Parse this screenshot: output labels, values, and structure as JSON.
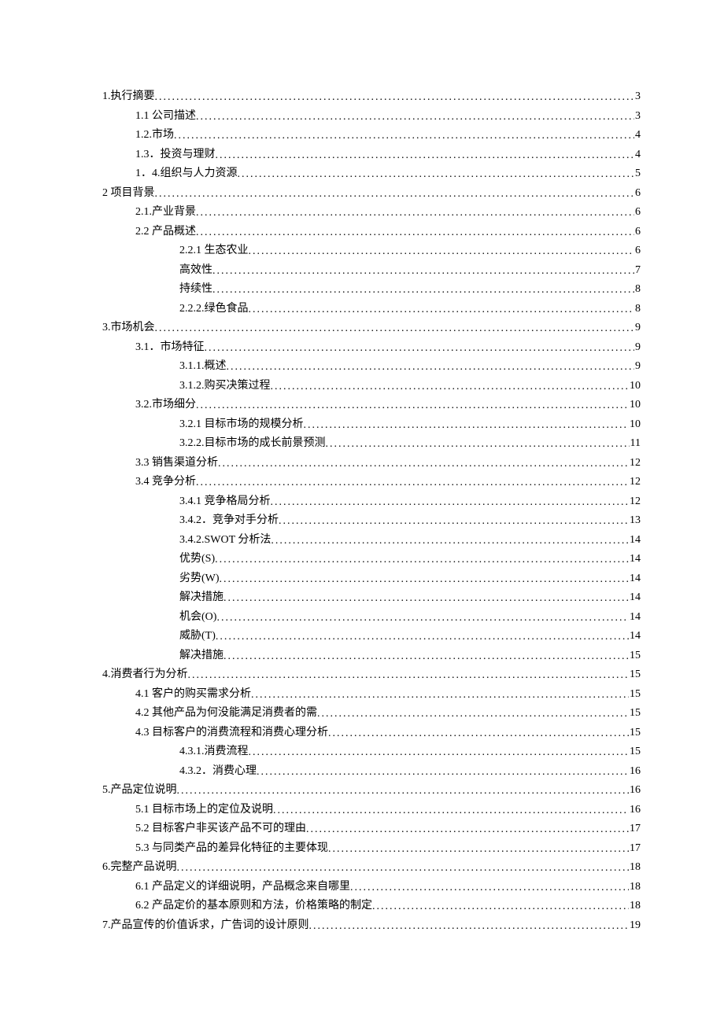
{
  "entries": [
    {
      "title": "1.执行摘要",
      "page": "3",
      "level": 0
    },
    {
      "title": "1.1 公司描述",
      "page": "3",
      "level": 1
    },
    {
      "title": "1.2.市场",
      "page": "4",
      "level": 1
    },
    {
      "title": "1.3．投资与理财",
      "page": "4",
      "level": 1
    },
    {
      "title": "1．4.组织与人力资源",
      "page": "5",
      "level": 1
    },
    {
      "title": "2 项目背景",
      "page": "6",
      "level": 0
    },
    {
      "title": "2.1.产业背景",
      "page": "6",
      "level": 1
    },
    {
      "title": "2.2 产品概述",
      "page": "6",
      "level": 1
    },
    {
      "title": "2.2.1 生态农业",
      "page": "6",
      "level": 2
    },
    {
      "title": "高效性",
      "page": "7",
      "level": 2
    },
    {
      "title": "持续性",
      "page": "8",
      "level": 2
    },
    {
      "title": "2.2.2.绿色食品",
      "page": "8",
      "level": 2
    },
    {
      "title": "3.市场机会",
      "page": "9",
      "level": 0
    },
    {
      "title": "3.1．市场特征",
      "page": "9",
      "level": 1
    },
    {
      "title": "3.1.1.概述",
      "page": "9",
      "level": 2
    },
    {
      "title": "3.1.2.购买决策过程",
      "page": "10",
      "level": 2
    },
    {
      "title": "3.2.市场细分",
      "page": "10",
      "level": 1
    },
    {
      "title": "3.2.1 目标市场的规模分析",
      "page": "10",
      "level": 2
    },
    {
      "title": "3.2.2.目标市场的成长前景预测",
      "page": "11",
      "level": 2
    },
    {
      "title": "3.3 销售渠道分析",
      "page": "12",
      "level": 1
    },
    {
      "title": "3.4 竞争分析",
      "page": "12",
      "level": 1
    },
    {
      "title": "3.4.1 竞争格局分析",
      "page": "12",
      "level": 2
    },
    {
      "title": "3.4.2．竞争对手分析",
      "page": "13",
      "level": 2
    },
    {
      "title": "3.4.2.SWOT 分析法",
      "page": "14",
      "level": 2
    },
    {
      "title": "优势(S)",
      "page": "14",
      "level": 2
    },
    {
      "title": "劣势(W)",
      "page": "14",
      "level": 2
    },
    {
      "title": "解决措施",
      "page": "14",
      "level": 2
    },
    {
      "title": "机会(O)",
      "page": "14",
      "level": 2
    },
    {
      "title": "威胁(T)",
      "page": "14",
      "level": 2
    },
    {
      "title": "解决措施",
      "page": "15",
      "level": 2
    },
    {
      "title": "4.消费者行为分析",
      "page": "15",
      "level": 0
    },
    {
      "title": "4.1 客户的购买需求分析",
      "page": "15",
      "level": 1
    },
    {
      "title": "4.2 其他产品为何没能满足消费者的需",
      "page": "15",
      "level": 1
    },
    {
      "title": "4.3 目标客户的消费流程和消费心理分析",
      "page": "15",
      "level": 1
    },
    {
      "title": "4.3.1.消费流程",
      "page": "15",
      "level": 2
    },
    {
      "title": "4.3.2．消费心理",
      "page": "16",
      "level": 2
    },
    {
      "title": "5.产品定位说明",
      "page": "16",
      "level": 0
    },
    {
      "title": "5.1 目标市场上的定位及说明",
      "page": "16",
      "level": 1
    },
    {
      "title": "5.2 目标客户非买该产品不可的理由",
      "page": "17",
      "level": 1
    },
    {
      "title": "5.3 与同类产品的差异化特征的主要体现",
      "page": "17",
      "level": 1
    },
    {
      "title": "6.完整产品说明",
      "page": "18",
      "level": 0
    },
    {
      "title": "6.1 产品定义的详细说明，产品概念来自哪里",
      "page": "18",
      "level": 1
    },
    {
      "title": "6.2 产品定价的基本原则和方法，价格策略的制定",
      "page": "18",
      "level": 1
    },
    {
      "title": "7.产品宣传的价值诉求，广告词的设计原则",
      "page": "19",
      "level": 0
    }
  ]
}
